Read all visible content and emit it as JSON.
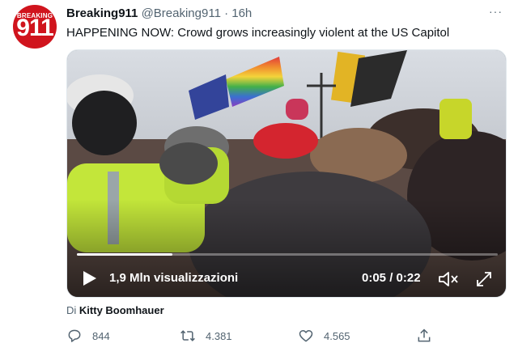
{
  "account": {
    "avatar_top": "BREAKING",
    "avatar_number": "911",
    "name": "Breaking911",
    "handle": "@Breaking911",
    "separator": "·",
    "time": "16h"
  },
  "more_icon": "···",
  "tweet": {
    "text": "HAPPENING NOW: Crowd grows increasingly violent at the US Capitol"
  },
  "video": {
    "views": "1,9 Mln visualizzazioni",
    "timecode": "0:05 / 0:22",
    "progress": 0.227,
    "icons": [
      "play-icon",
      "mute-icon",
      "fullscreen-icon"
    ]
  },
  "credit": {
    "prefix": "Di",
    "author": "Kitty Boomhauer"
  },
  "actions": {
    "reply_count": "844",
    "retweet_count": "4.381",
    "like_count": "4.565",
    "icons": [
      "reply-icon",
      "retweet-icon",
      "like-icon",
      "share-icon"
    ]
  },
  "colors": {
    "brand_red": "#d0141d",
    "text_primary": "#0f1419",
    "text_secondary": "#536471"
  }
}
